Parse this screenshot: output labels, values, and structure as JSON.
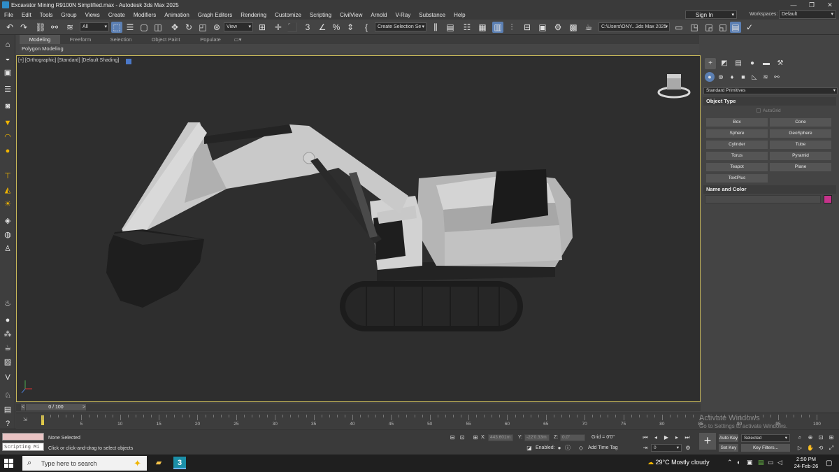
{
  "window": {
    "title": "Excavator Mining R9100N Simplified.max - Autodesk 3ds Max 2025",
    "minimize": "—",
    "maximize": "❐",
    "close": "✕"
  },
  "menu": [
    "File",
    "Edit",
    "Tools",
    "Group",
    "Views",
    "Create",
    "Modifiers",
    "Animation",
    "Graph Editors",
    "Rendering",
    "Customize",
    "Scripting",
    "CivilView",
    "Arnold",
    "V-Ray",
    "Substance",
    "Help"
  ],
  "signin": "Sign In",
  "workspaces": {
    "label": "Workspaces:",
    "value": "Default"
  },
  "toolbar": {
    "selection_filter": "All",
    "ref_coord": "View",
    "selection_set": "Create Selection Se",
    "project_path": "C:\\Users\\ONY...3ds Max 2025"
  },
  "ribbon": {
    "tabs": [
      "Modeling",
      "Freeform",
      "Selection",
      "Object Paint",
      "Populate"
    ],
    "sub": "Polygon Modeling"
  },
  "viewport": {
    "label": "[+] [Orthographic] [Standard] [Default Shading]",
    "shading_color": "#4b78c8"
  },
  "command_panel": {
    "category": "Standard Primitives",
    "object_type_title": "Object Type",
    "autogrid": "AutoGrid",
    "primitives": [
      "Box",
      "Cone",
      "Sphere",
      "GeoSphere",
      "Cylinder",
      "Tube",
      "Torus",
      "Pyramid",
      "Teapot",
      "Plane",
      "TextPlus"
    ],
    "name_color_title": "Name and Color",
    "object_color": "#c6338b"
  },
  "frames": {
    "slider": "0 / 100",
    "prev": "<",
    "next": ">"
  },
  "timeline": {
    "current_frame": 0,
    "ticks": [
      "5",
      "10",
      "15",
      "20",
      "25",
      "30",
      "35",
      "40",
      "45",
      "50",
      "55",
      "60",
      "65",
      "70",
      "75",
      "80",
      "85",
      "90",
      "95",
      "100"
    ]
  },
  "status": {
    "selection": "None Selected",
    "prompt": "Click or click-and-drag to select objects",
    "script_placeholder": "Scripting Mi",
    "x_label": "X:",
    "x_value": "443.601m",
    "y_label": "Y:",
    "y_value": "-22'0.33m",
    "z_label": "Z:",
    "z_value": "0.0\"",
    "grid": "Grid = 0'0\"",
    "enabled": "Enabled:",
    "add_time_tag": "Add Time Tag",
    "auto_key": "Auto Key",
    "set_key": "Set Key",
    "key_mode": "Selected",
    "key_filters": "Key Filters...",
    "frame_field": "0"
  },
  "activation": {
    "line1": "Activate Windows",
    "line2": "Go to Settings to activate Windows."
  },
  "taskbar": {
    "search_placeholder": "Type here to search",
    "weather": "29°C  Mostly cloudy",
    "time": "2:50 PM",
    "date": "24-Feb-26"
  }
}
